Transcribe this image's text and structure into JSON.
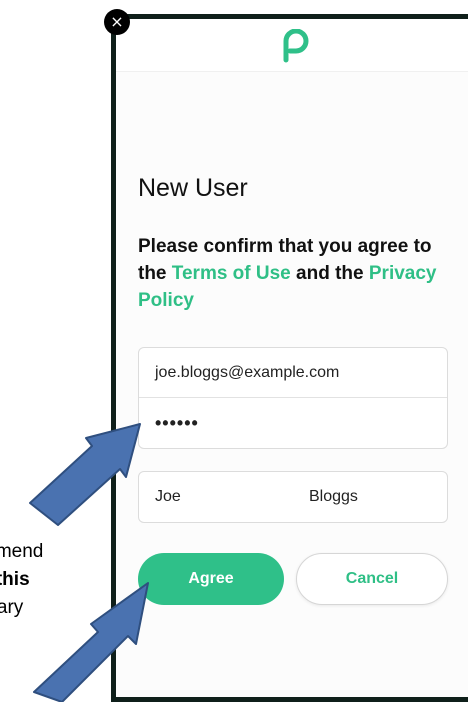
{
  "background_doc": {
    "line1": "mmend",
    "line2_prefix": "h ",
    "line2_bold": "this",
    "line3": "brary"
  },
  "modal": {
    "close_glyph": "×",
    "title": "New User",
    "confirm": {
      "prefix": "Please confirm that you agree to the ",
      "terms_link": "Terms of Use",
      "middle": " and the ",
      "privacy_link": "Privacy Policy"
    },
    "email_value": "joe.bloggs@example.com",
    "password_value": "••••••",
    "first_name": "Joe",
    "last_name": "Bloggs",
    "agree_label": "Agree",
    "cancel_label": "Cancel"
  },
  "colors": {
    "accent": "#2fc089",
    "frame": "#0f1f1a",
    "arrow_fill": "#4a72b0",
    "arrow_stroke": "#2f4f7f"
  },
  "icons": {
    "logo": "p-logo-icon",
    "close": "close-icon",
    "annotation": "arrow-icon"
  }
}
